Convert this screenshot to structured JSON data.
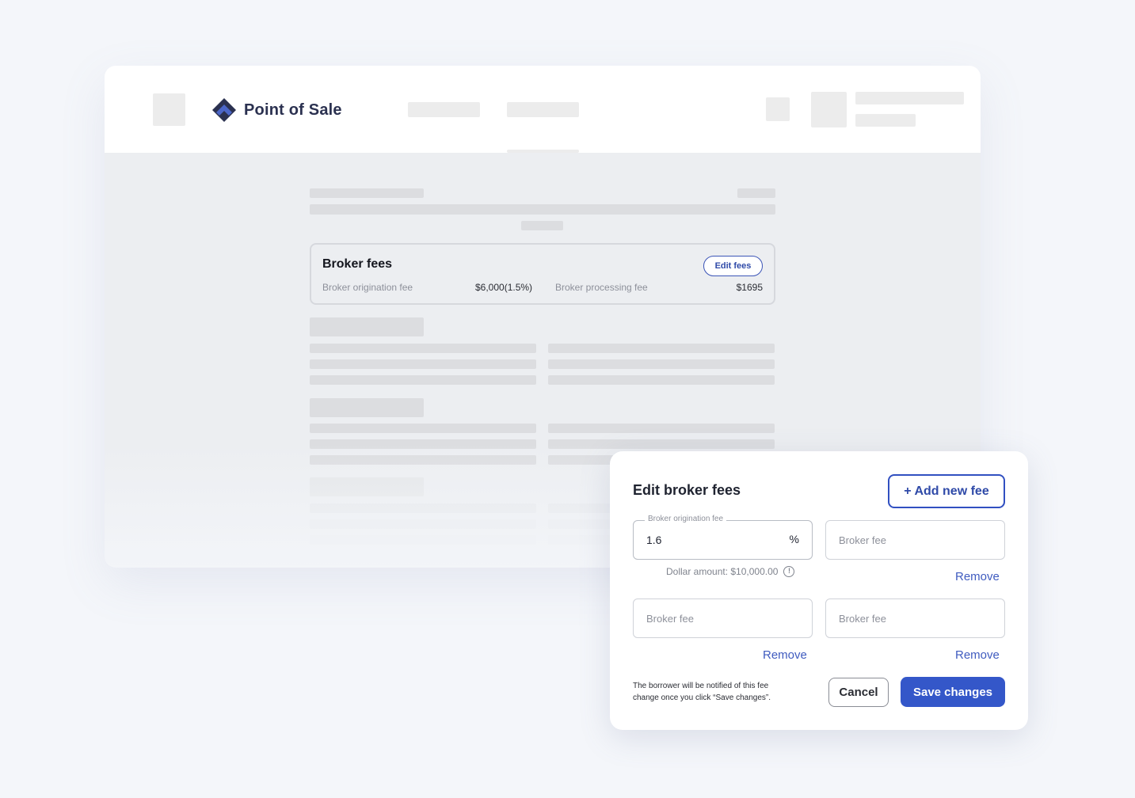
{
  "header": {
    "brand_name": "Point of Sale",
    "logo_icon": "diamond-chevron-logo-icon",
    "brand_color": "#2b3150",
    "accent_color": "#3c55b7"
  },
  "broker_fees_card": {
    "title": "Broker fees",
    "edit_label": "Edit fees",
    "origination_label": "Broker origination fee",
    "origination_value": "$6,000(1.5%)",
    "processing_label": "Broker processing fee",
    "processing_value": "$1695"
  },
  "modal": {
    "title": "Edit broker fees",
    "add_label": "+ Add new fee",
    "origination_field": {
      "label": "Broker origination fee",
      "value": "1.6",
      "suffix": "%"
    },
    "helper_text": "Dollar amount: $10,000.00",
    "info_icon": "info-icon",
    "fields": [
      {
        "placeholder": "Broker fee"
      },
      {
        "placeholder": "Broker fee"
      },
      {
        "placeholder": "Broker fee"
      }
    ],
    "remove_label": "Remove",
    "notice_line1": "The borrower will be notified of this fee",
    "notice_line2": "change once you click “Save changes”.",
    "cancel_label": "Cancel",
    "save_label": "Save changes",
    "primary_color": "#3457c9"
  }
}
